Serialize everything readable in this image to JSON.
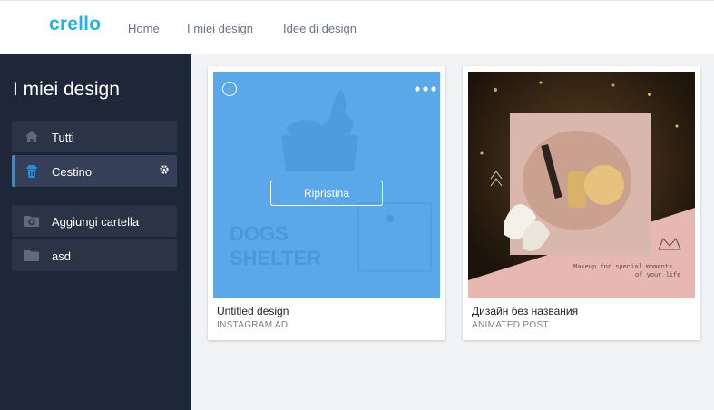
{
  "app": {
    "logo": "crello"
  },
  "nav": {
    "home": "Home",
    "my_designs": "I miei design",
    "ideas": "Idee di design"
  },
  "sidebar": {
    "title": "I miei design",
    "items": [
      {
        "label": "Tutti",
        "icon": "home-icon"
      },
      {
        "label": "Cestino",
        "icon": "trash-icon",
        "active": true
      },
      {
        "label": "Aggiungi cartella",
        "icon": "add-folder-icon"
      },
      {
        "label": "asd",
        "icon": "folder-icon"
      }
    ]
  },
  "designs": [
    {
      "title": "Untitled design",
      "type": "INSTAGRAM AD",
      "restore_label": "Ripristina",
      "thumbnail_text": {
        "line1": "DOGS",
        "line2": "SHELTER"
      }
    },
    {
      "title": "Дизайн без названия",
      "type": "ANIMATED POST",
      "thumbnail_text": {
        "caption_line1": "Makeup for special moments",
        "caption_line2": "of your life"
      }
    }
  ],
  "colors": {
    "accent": "#1fb4e3",
    "sidebar_bg": "#1e2738",
    "sidebar_item_bg": "#2a3446",
    "active_marker": "#2a8fe0",
    "thumb_blue": "#5aa8e9"
  }
}
